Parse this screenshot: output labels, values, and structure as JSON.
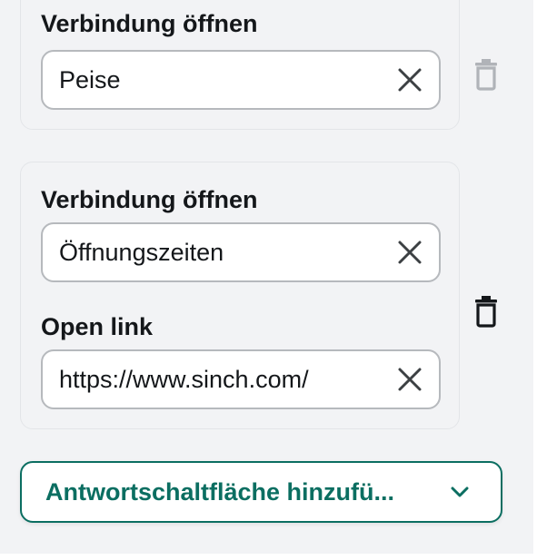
{
  "card1": {
    "label": "Verbindung öffnen",
    "field_value": "Peise",
    "clear_icon": "close-icon",
    "delete_icon": "trash-icon"
  },
  "card2": {
    "label1": "Verbindung öffnen",
    "field1_value": "Öffnungszeiten",
    "label2": "Open link",
    "field2_value": "https://www.sinch.com/",
    "clear_icon": "close-icon",
    "delete_icon": "trash-icon"
  },
  "add_button": {
    "label": "Antwortschaltfläche hinzufü...",
    "icon": "chevron-down-icon"
  },
  "colors": {
    "accent": "#0b6e61",
    "panel_bg": "#f2f3f5",
    "border": "#b6b9bd",
    "text": "#14171a",
    "trash_disabled": "#b0b3b8"
  }
}
